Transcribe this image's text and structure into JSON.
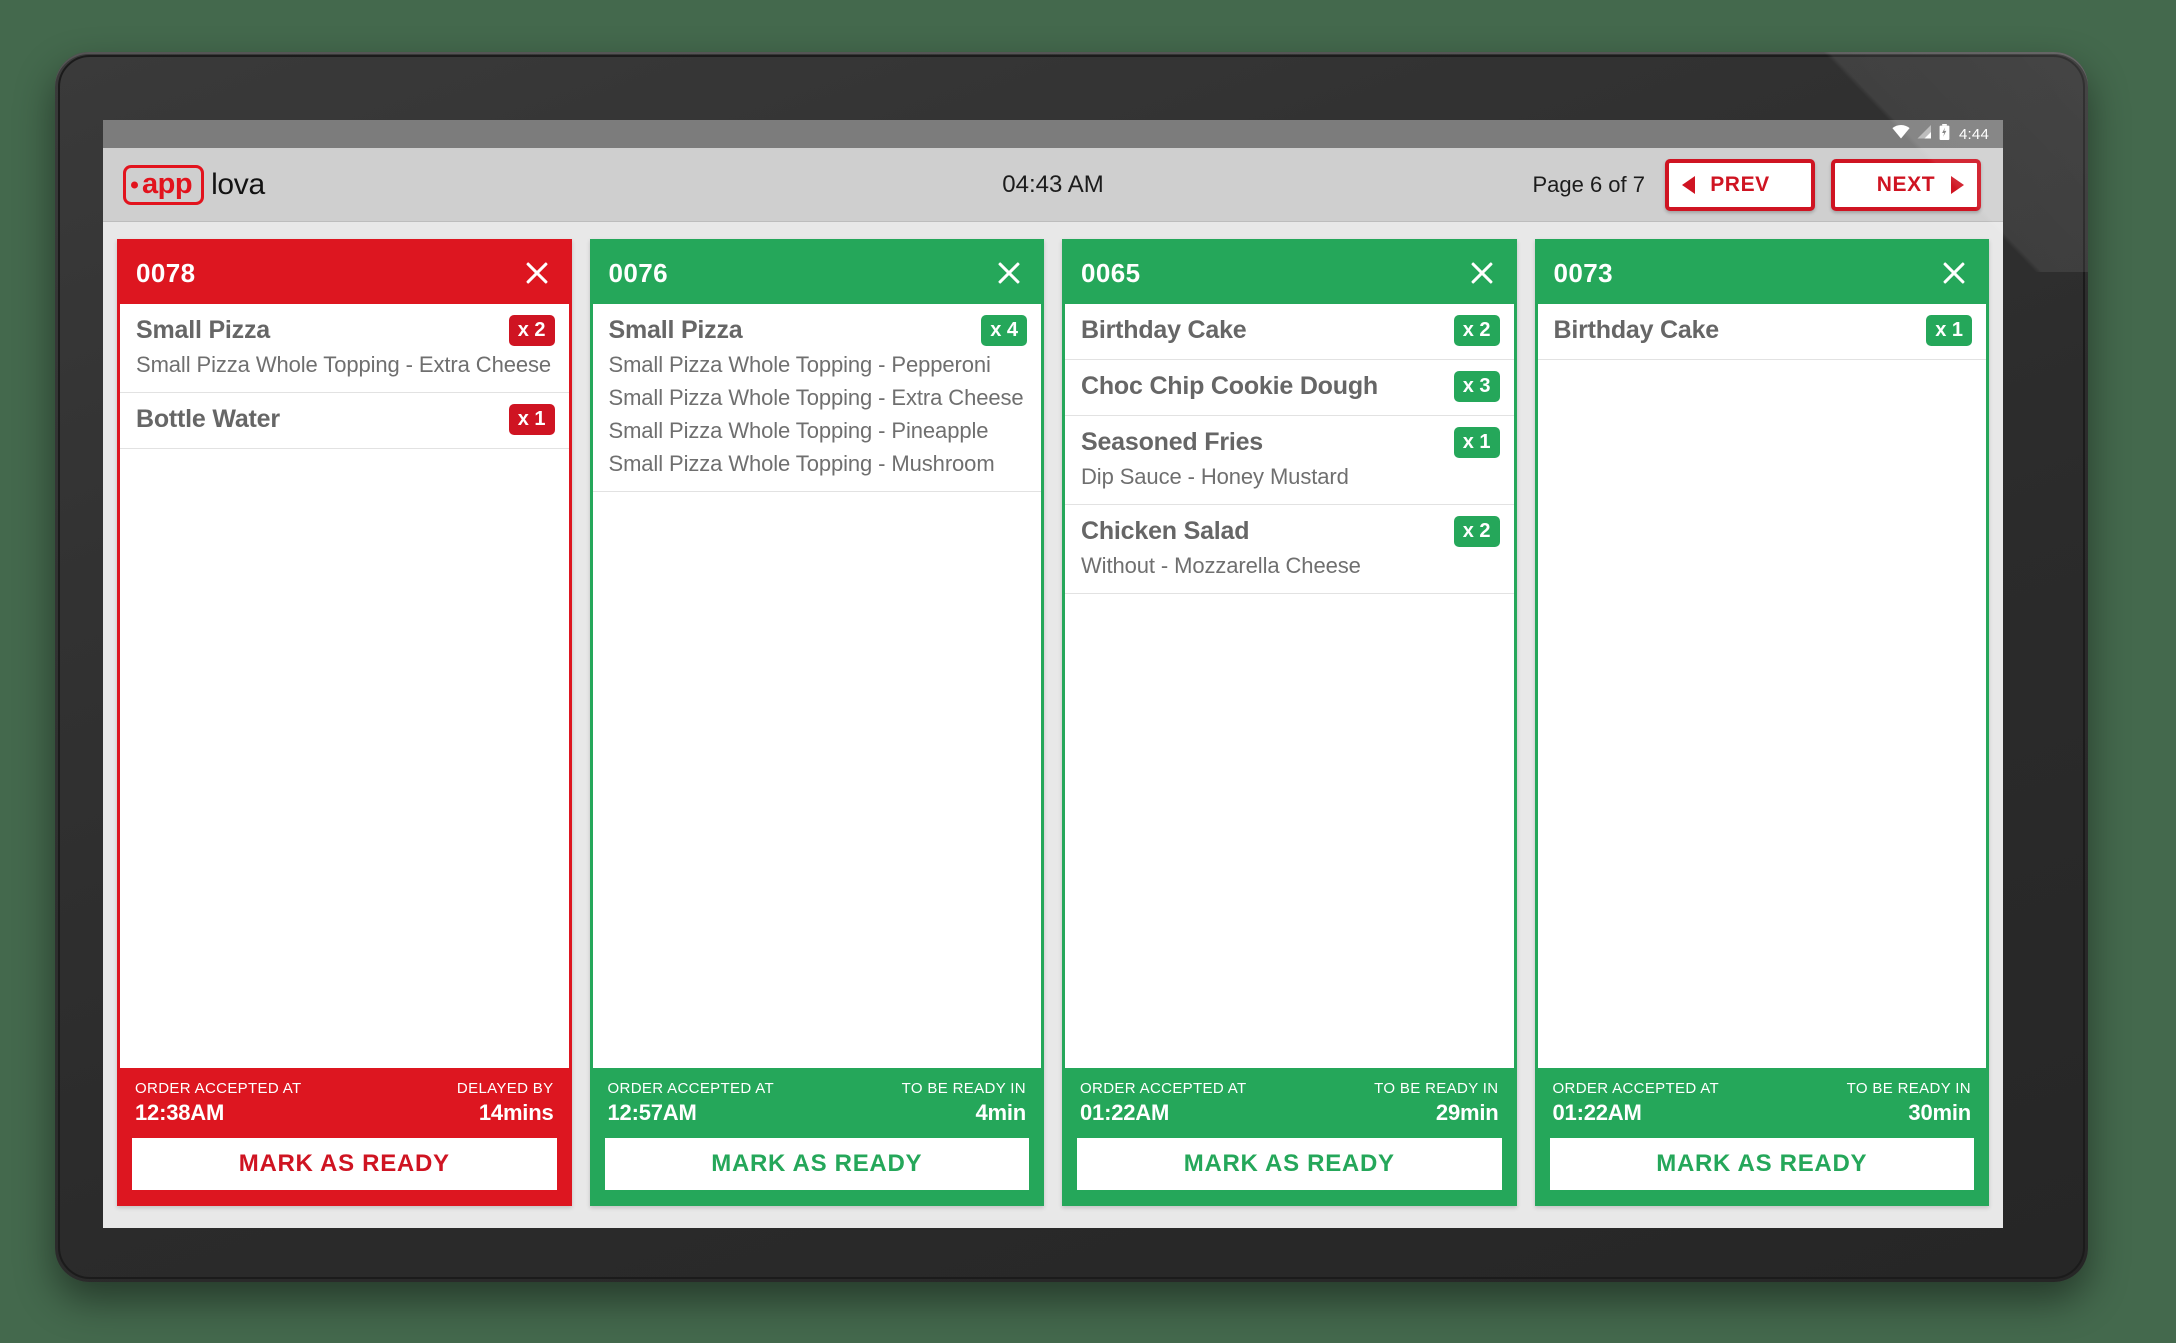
{
  "device": {
    "status_bar": {
      "icons": [
        "wifi-icon",
        "signal-icon",
        "battery-charging-icon"
      ],
      "clock": "4:44"
    }
  },
  "header": {
    "logo_tag_text": "app",
    "logo_word": "lova",
    "clock": "04:43 AM",
    "page_indicator": "Page 6 of 7",
    "prev_label": "PREV",
    "next_label": "NEXT"
  },
  "colors": {
    "delayed_red": "#dd1620",
    "ontime_green": "#25a75a",
    "brand_red": "#e2131d",
    "board_bg": "#e8e8e8",
    "page_bg": "#44694d"
  },
  "labels": {
    "accepted_at": "ORDER ACCEPTED AT",
    "delayed_by": "DELAYED BY",
    "ready_in": "TO BE READY IN",
    "mark_ready": "MARK AS READY"
  },
  "orders": [
    {
      "number": "0078",
      "status": "delayed",
      "items": [
        {
          "name": "Small Pizza",
          "qty": "x 2",
          "mods": [
            "Small Pizza Whole Topping - Extra Cheese"
          ]
        },
        {
          "name": "Bottle Water",
          "qty": "x 1",
          "mods": []
        }
      ],
      "accepted_label": "ORDER ACCEPTED AT",
      "accepted_time": "12:38AM",
      "timer_label": "DELAYED BY",
      "timer_value": "14mins",
      "action": "MARK AS READY"
    },
    {
      "number": "0076",
      "status": "ontime",
      "items": [
        {
          "name": "Small Pizza",
          "qty": "x 4",
          "mods": [
            "Small Pizza Whole Topping - Pepperoni",
            "Small Pizza Whole Topping - Extra Cheese",
            "Small Pizza Whole Topping - Pineapple",
            "Small Pizza Whole Topping - Mushroom"
          ]
        }
      ],
      "accepted_label": "ORDER ACCEPTED AT",
      "accepted_time": "12:57AM",
      "timer_label": "TO BE READY IN",
      "timer_value": "4min",
      "action": "MARK AS READY"
    },
    {
      "number": "0065",
      "status": "ontime",
      "items": [
        {
          "name": "Birthday Cake",
          "qty": "x 2",
          "mods": []
        },
        {
          "name": "Choc Chip Cookie Dough",
          "qty": "x 3",
          "mods": []
        },
        {
          "name": "Seasoned Fries",
          "qty": "x 1",
          "mods": [
            "Dip Sauce - Honey Mustard"
          ]
        },
        {
          "name": "Chicken Salad",
          "qty": "x 2",
          "mods": [
            "Without - Mozzarella Cheese"
          ]
        }
      ],
      "accepted_label": "ORDER ACCEPTED AT",
      "accepted_time": "01:22AM",
      "timer_label": "TO BE READY IN",
      "timer_value": "29min",
      "action": "MARK AS READY"
    },
    {
      "number": "0073",
      "status": "ontime",
      "items": [
        {
          "name": "Birthday Cake",
          "qty": "x 1",
          "mods": []
        }
      ],
      "accepted_label": "ORDER ACCEPTED AT",
      "accepted_time": "01:22AM",
      "timer_label": "TO BE READY IN",
      "timer_value": "30min",
      "action": "MARK AS READY"
    }
  ]
}
